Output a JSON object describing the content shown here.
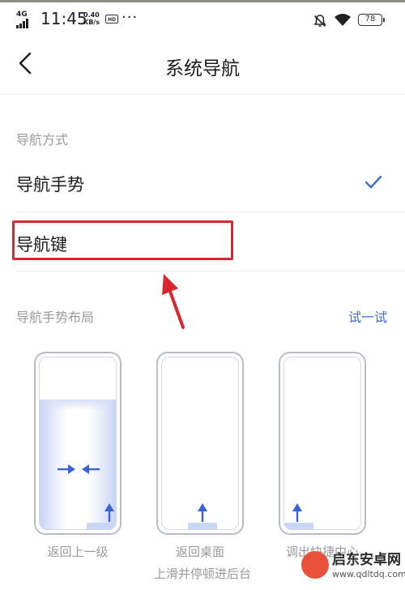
{
  "status_bar": {
    "network": "4G",
    "time": "11:45",
    "speed_value": "0.40",
    "speed_unit": "KB/s",
    "app_badge": "HD",
    "more": "···",
    "battery": "78"
  },
  "header": {
    "title": "系统导航"
  },
  "nav_mode": {
    "section_label": "导航方式",
    "options": [
      {
        "label": "导航手势",
        "selected": true
      },
      {
        "label": "导航键",
        "selected": false
      }
    ]
  },
  "gesture_layout": {
    "section_label": "导航手势布局",
    "try_label": "试一试",
    "phones": [
      {
        "caption": "返回上一级"
      },
      {
        "caption": "返回桌面",
        "subcaption": "上滑并停顿进后台"
      },
      {
        "caption": "调出快捷中心"
      }
    ]
  },
  "watermark": {
    "brand": "启东安卓网",
    "url": "www.qdltdq.com"
  },
  "colors": {
    "accent": "#3d6fd6",
    "highlight": "#d9262e",
    "secondary_text": "#9a9a9a"
  }
}
